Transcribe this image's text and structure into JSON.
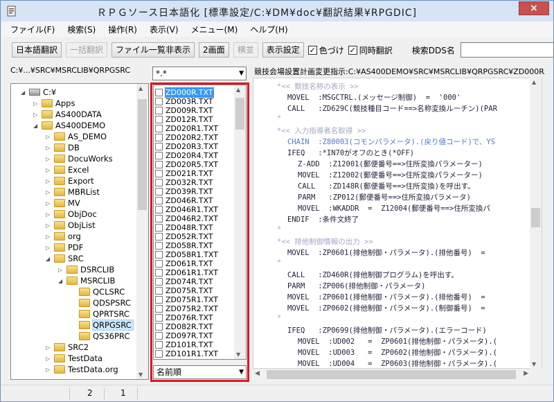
{
  "window": {
    "title": "ＲＰＧソース日本語化 [標準設定/C:¥DM¥doc¥翻訳結果¥RPGDIC]",
    "close_label": "×"
  },
  "menu": [
    "ファイル(F)",
    "検索(S)",
    "操作(R)",
    "表示(V)",
    "メニュー(M)",
    "ヘルプ(H)"
  ],
  "toolbar": {
    "buttons": [
      "日本語翻訳",
      "一括翻訳",
      "ファイル一覧非表示",
      "2画面",
      "横並",
      "表示設定"
    ],
    "disabled": [
      false,
      true,
      false,
      false,
      true,
      false
    ],
    "checkboxes": [
      {
        "label": "色づけ",
        "checked": true
      },
      {
        "label": "同時翻訳",
        "checked": true
      }
    ],
    "search_label": "検索DDS名",
    "search_value": ""
  },
  "paths": {
    "left": "C:¥...¥SRC¥MSRCLIB¥QRPGSRC",
    "filter": "*.*",
    "right": "競技会場設置計画変更指示:C:¥AS400DEMO¥SRC¥MSRCLIB¥QRPGSRC¥ZD000R.TXT"
  },
  "tree": [
    {
      "label": "C:¥",
      "icon": "drive-icon",
      "depth": 0,
      "expander": "◢"
    },
    {
      "label": "Apps",
      "depth": 1,
      "expander": "▷"
    },
    {
      "label": "AS400DATA",
      "depth": 1,
      "expander": "▷"
    },
    {
      "label": "AS400DEMO",
      "depth": 1,
      "expander": "◢"
    },
    {
      "label": "AS_DEMO",
      "depth": 2,
      "expander": "▷"
    },
    {
      "label": "DB",
      "depth": 2,
      "expander": "▷"
    },
    {
      "label": "DocuWorks",
      "depth": 2,
      "expander": "▷"
    },
    {
      "label": "Excel",
      "depth": 2,
      "expander": "▷"
    },
    {
      "label": "Export",
      "depth": 2,
      "expander": "▷"
    },
    {
      "label": "MBRList",
      "depth": 2,
      "expander": "▷"
    },
    {
      "label": "MV",
      "depth": 2,
      "expander": "▷"
    },
    {
      "label": "ObjDoc",
      "depth": 2,
      "expander": "▷"
    },
    {
      "label": "ObjList",
      "depth": 2,
      "expander": "▷"
    },
    {
      "label": "org",
      "depth": 2,
      "expander": "▷"
    },
    {
      "label": "PDF",
      "depth": 2,
      "expander": "▷"
    },
    {
      "label": "SRC",
      "depth": 2,
      "expander": "◢"
    },
    {
      "label": "DSRCLIB",
      "depth": 3,
      "expander": "▷"
    },
    {
      "label": "MSRCLIB",
      "depth": 3,
      "expander": "◢"
    },
    {
      "label": "QCLSRC",
      "depth": 4,
      "expander": ""
    },
    {
      "label": "QDSPSRC",
      "depth": 4,
      "expander": ""
    },
    {
      "label": "QPRTSRC",
      "depth": 4,
      "expander": ""
    },
    {
      "label": "QRPGSRC",
      "depth": 4,
      "expander": "",
      "selected": true
    },
    {
      "label": "QS36PRC",
      "depth": 4,
      "expander": ""
    },
    {
      "label": "SRC2",
      "depth": 2,
      "expander": "▷"
    },
    {
      "label": "TestData",
      "depth": 2,
      "expander": "▷"
    },
    {
      "label": "TestData.org",
      "depth": 2,
      "expander": "▷"
    }
  ],
  "files": [
    "ZD000R.TXT",
    "ZD003R.TXT",
    "ZD009R.TXT",
    "ZD012R.TXT",
    "ZD020R1.TXT",
    "ZD020R2.TXT",
    "ZD020R3.TXT",
    "ZD020R4.TXT",
    "ZD020R5.TXT",
    "ZD021R.TXT",
    "ZD032R.TXT",
    "ZD039R.TXT",
    "ZD046R.TXT",
    "ZD046R1.TXT",
    "ZD046R2.TXT",
    "ZD048R.TXT",
    "ZD052R.TXT",
    "ZD058R.TXT",
    "ZD058R1.TXT",
    "ZD061R.TXT",
    "ZD061R1.TXT",
    "ZD074R.TXT",
    "ZD075R.TXT",
    "ZD075R1.TXT",
    "ZD075R2.TXT",
    "ZD076R.TXT",
    "ZD082R.TXT",
    "ZD097R.TXT",
    "ZD101R.TXT",
    "ZD101R1.TXT"
  ],
  "sort_label": "名前順",
  "code": [
    {
      "indent": 4,
      "cls": "c-grey",
      "text": "*<< 競技名称の表示 >>"
    },
    {
      "indent": 6,
      "cls": "c-black",
      "text": "MOVEL  :MSGCTRL.(メッセージ制御)  =  '000'"
    },
    {
      "indent": 6,
      "cls": "c-black",
      "text": "CALL   :ZD629C(競技種目コード==>名称変換ルーチン)(PAR"
    },
    {
      "indent": 4,
      "cls": "c-grey",
      "text": "*"
    },
    {
      "indent": 4,
      "cls": "c-grey",
      "text": "*<< 入力指導者名取得 >>"
    },
    {
      "indent": 6,
      "cls": "c-blue",
      "text": "CHAIN  :Z80003(コモンパラメータ).(戻り値コード)で、YS"
    },
    {
      "indent": 6,
      "cls": "c-black",
      "text": "IFEQ   :*IN70がオフのとき(*OFF)"
    },
    {
      "indent": 8,
      "cls": "c-black",
      "text": "Z-ADD  :Z12001(郵便番号==>住所変換パラメーター)"
    },
    {
      "indent": 8,
      "cls": "c-black",
      "text": "MOVEL  :Z12002(郵便番号==>住所変換パラメーター)"
    },
    {
      "indent": 8,
      "cls": "c-black",
      "text": "CALL   :ZD148R(郵便番号==>住所変換)を呼出す。"
    },
    {
      "indent": 8,
      "cls": "c-black",
      "text": "PARM   :ZP012(郵便番号==>住所変換パラメータ)"
    },
    {
      "indent": 8,
      "cls": "c-black",
      "text": "MOVEL  :WKADDR  =  Z12004(郵便番号==>住所変換パ"
    },
    {
      "indent": 6,
      "cls": "c-black",
      "text": "ENDIF  :条件文終了"
    },
    {
      "indent": 4,
      "cls": "c-grey",
      "text": "*"
    },
    {
      "indent": 4,
      "cls": "c-grey",
      "text": "*<< 排他制御情報の出力 >>"
    },
    {
      "indent": 6,
      "cls": "c-black",
      "text": "MOVEL  :ZP0601(排他制御・パラメータ).(排他番号)  ="
    },
    {
      "indent": 4,
      "cls": "c-grey",
      "text": "*"
    },
    {
      "indent": 6,
      "cls": "c-black",
      "text": "CALL   :ZD460R(排他制御プログラム)を呼出す。"
    },
    {
      "indent": 6,
      "cls": "c-black",
      "text": "PARM   :ZP006(排他制御・パラメータ)"
    },
    {
      "indent": 6,
      "cls": "c-black",
      "text": "MOVEL  :ZP0601(排他制御・パラメータ).(排他番号)  ="
    },
    {
      "indent": 6,
      "cls": "c-black",
      "text": "MOVEL  :ZP0602(排他制御・パラメータ).(制御番号)  ="
    },
    {
      "indent": 4,
      "cls": "c-grey",
      "text": "*"
    },
    {
      "indent": 6,
      "cls": "c-black",
      "text": "IFEQ   :ZP0699(排他制御・パラメータ).(エラーコード)"
    },
    {
      "indent": 8,
      "cls": "c-black",
      "text": "MOVEL  :UD002   =  ZP0601(排他制御・パラメータ).("
    },
    {
      "indent": 8,
      "cls": "c-black",
      "text": "MOVEL  :UD003   =  ZP0602(排他制御・パラメータ).("
    },
    {
      "indent": 8,
      "cls": "c-black",
      "text": "MOVEL  :UD004   =  ZP0603(排他制御・パラメータ).("
    }
  ],
  "status": [
    "2",
    "1"
  ]
}
